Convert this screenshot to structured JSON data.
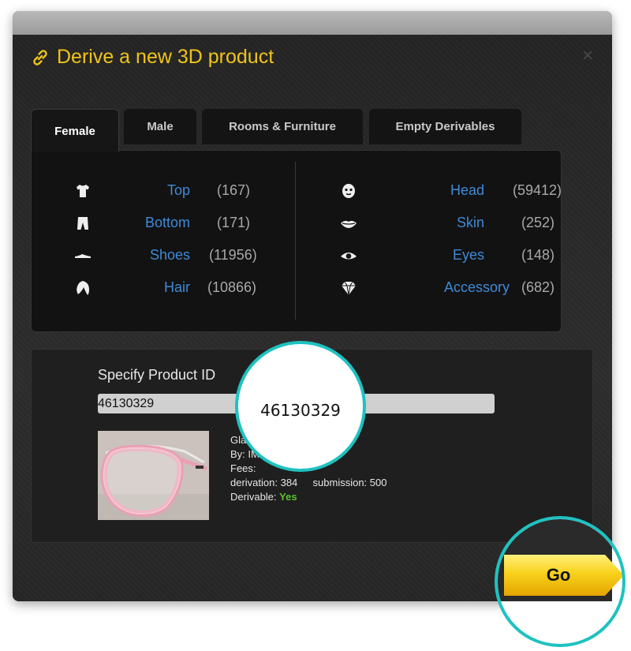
{
  "dialog": {
    "title": "Derive a new 3D product",
    "close_label": "×"
  },
  "tabs": [
    {
      "label": "Female",
      "active": true
    },
    {
      "label": "Male",
      "active": false
    },
    {
      "label": "Rooms & Furniture",
      "active": false
    },
    {
      "label": "Empty Derivables",
      "active": false
    }
  ],
  "categories": {
    "left": [
      {
        "label": "Top",
        "count": "(167)",
        "icon": "shirt-icon"
      },
      {
        "label": "Bottom",
        "count": "(171)",
        "icon": "pants-icon"
      },
      {
        "label": "Shoes",
        "count": "(11956)",
        "icon": "shoe-icon"
      },
      {
        "label": "Hair",
        "count": "(10866)",
        "icon": "hair-icon"
      }
    ],
    "right": [
      {
        "label": "Head",
        "count": "(59412)",
        "icon": "head-icon"
      },
      {
        "label": "Skin",
        "count": "(252)",
        "icon": "lips-icon"
      },
      {
        "label": "Eyes",
        "count": "(148)",
        "icon": "eye-icon"
      },
      {
        "label": "Accessory",
        "count": "(682)",
        "icon": "diamond-icon"
      }
    ]
  },
  "specify": {
    "label": "Specify Product ID",
    "product_id": "46130329"
  },
  "product": {
    "name_partial": "Gla",
    "by_label": "By: IM",
    "fees_label": "Fees:",
    "derivation": "derivation: 384",
    "submission": "submission: 500",
    "derivable_label": "Derivable:",
    "derivable_value": "Yes"
  },
  "go_button": {
    "label": "Go"
  },
  "colors": {
    "accent_yellow": "#f0c419",
    "link_blue": "#3f8ad8",
    "highlight_teal": "#1ec2c0",
    "yes_green": "#58c22c"
  }
}
